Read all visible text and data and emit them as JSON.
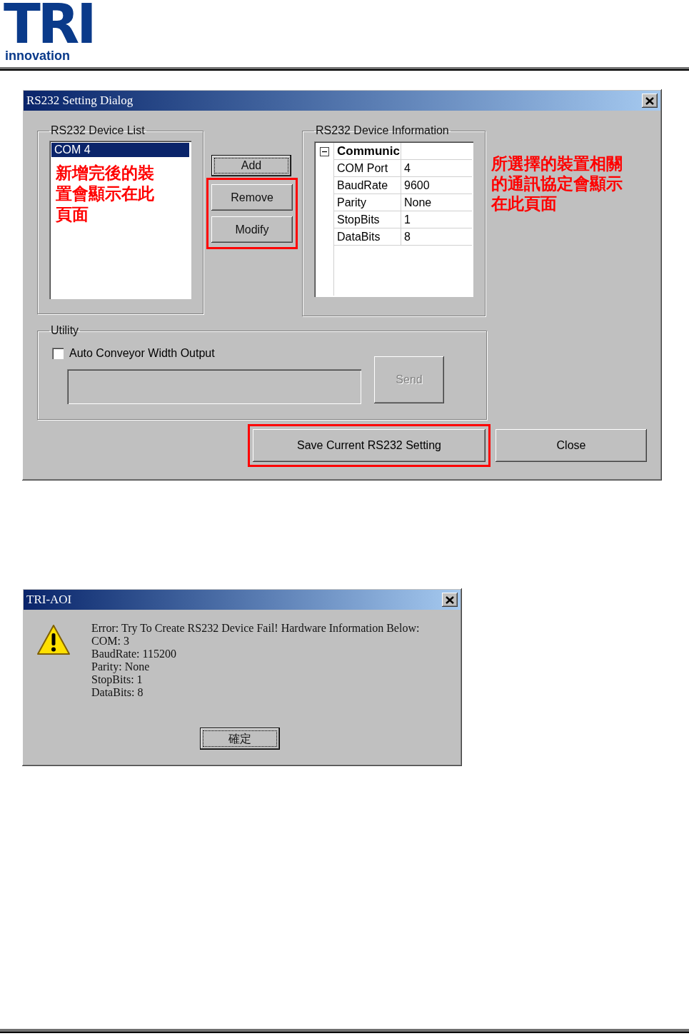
{
  "header": {
    "logo_mark": "TRI",
    "logo_tagline": "innovation"
  },
  "setting_dialog": {
    "title": "RS232 Setting Dialog",
    "device_list": {
      "legend": "RS232 Device List",
      "items": [
        {
          "label": "COM 4",
          "selected": true
        }
      ],
      "note": "新增完後的裝置會顯示在此頁面"
    },
    "buttons": [
      {
        "label": "Add",
        "focused": true,
        "highlighted": false
      },
      {
        "label": "Remove",
        "focused": false,
        "highlighted": true
      },
      {
        "label": "Modify",
        "focused": false,
        "highlighted": true
      }
    ],
    "device_info": {
      "legend": "RS232 Device Information",
      "category": {
        "label": "Communic",
        "expanded": true
      },
      "rows": [
        {
          "name": "COM Port",
          "value": "4"
        },
        {
          "name": "BaudRate",
          "value": "9600"
        },
        {
          "name": "Parity",
          "value": "None"
        },
        {
          "name": "StopBits",
          "value": "1"
        },
        {
          "name": "DataBits",
          "value": "8"
        }
      ]
    },
    "info_note": "所選擇的裝置相關的通訊協定會顯示在此頁面",
    "utility": {
      "legend": "Utility",
      "checkbox": {
        "label": "Auto Conveyor Width Output",
        "checked": false
      },
      "send_button": {
        "label": "Send",
        "disabled": true
      }
    },
    "footer_buttons": [
      {
        "label": "Save Current RS232 Setting",
        "highlighted": true
      },
      {
        "label": "Close",
        "highlighted": false
      }
    ]
  },
  "error_dialog": {
    "title": "TRI-AOI",
    "lines": [
      "Error: Try To Create RS232 Device Fail! Hardware Information Below:",
      "COM: 3",
      "BaudRate: 115200",
      "Parity: None",
      "StopBits: 1",
      "DataBits: 8"
    ],
    "ok_button": {
      "label": "確定",
      "focused": true
    }
  }
}
